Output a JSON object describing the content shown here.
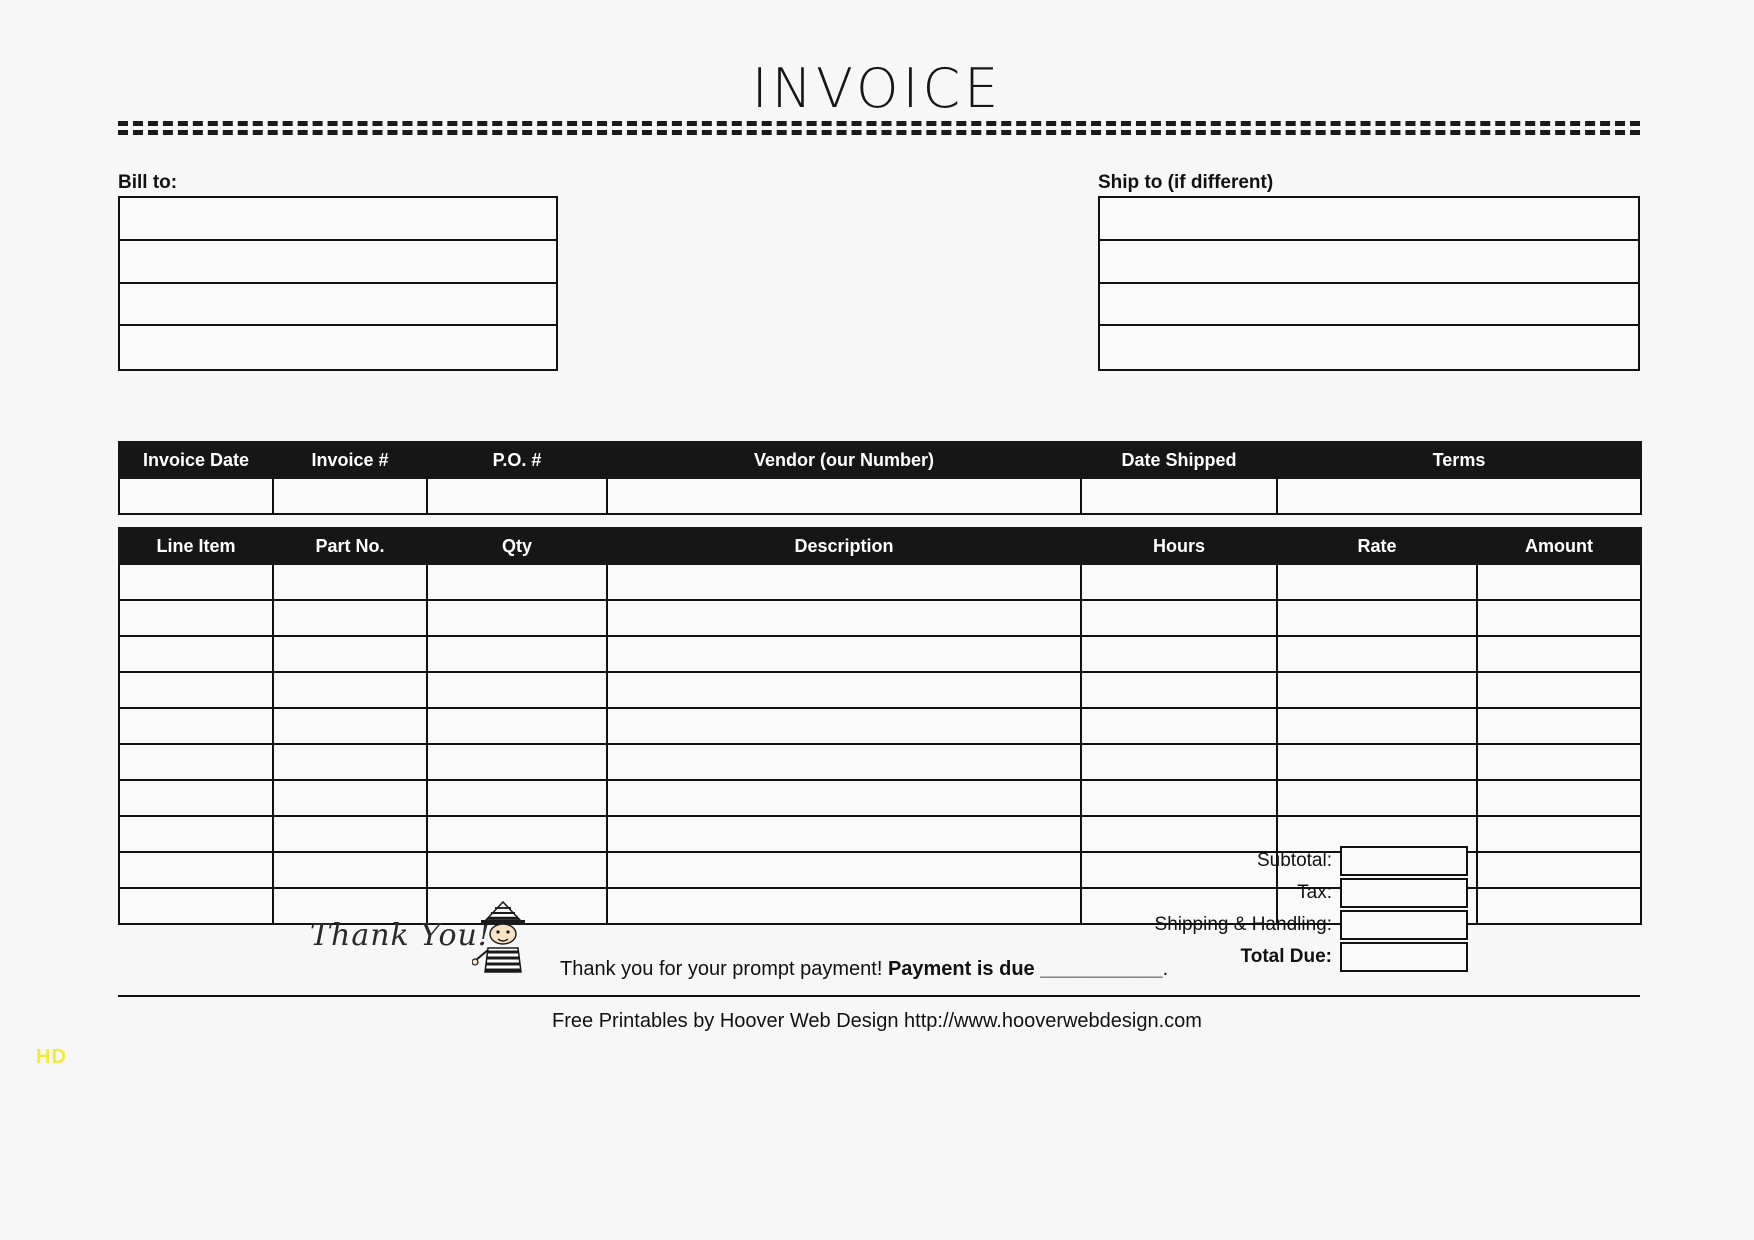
{
  "document": {
    "title": "INVOICE"
  },
  "bill_to": {
    "label": "Bill to:",
    "rows": [
      "",
      "",
      "",
      ""
    ]
  },
  "ship_to": {
    "label": "Ship to (if different)",
    "rows": [
      "",
      "",
      "",
      ""
    ]
  },
  "info_table": {
    "headers": [
      "Invoice Date",
      "Invoice #",
      "P.O. #",
      "Vendor (our Number)",
      "Date Shipped",
      "Terms"
    ],
    "values": [
      "",
      "",
      "",
      "",
      "",
      ""
    ]
  },
  "line_items_table": {
    "headers": [
      "Line Item",
      "Part No.",
      "Qty",
      "Description",
      "Hours",
      "Rate",
      "Amount"
    ],
    "rows": [
      [
        "",
        "",
        "",
        "",
        "",
        "",
        ""
      ],
      [
        "",
        "",
        "",
        "",
        "",
        "",
        ""
      ],
      [
        "",
        "",
        "",
        "",
        "",
        "",
        ""
      ],
      [
        "",
        "",
        "",
        "",
        "",
        "",
        ""
      ],
      [
        "",
        "",
        "",
        "",
        "",
        "",
        ""
      ],
      [
        "",
        "",
        "",
        "",
        "",
        "",
        ""
      ],
      [
        "",
        "",
        "",
        "",
        "",
        "",
        ""
      ],
      [
        "",
        "",
        "",
        "",
        "",
        "",
        ""
      ],
      [
        "",
        "",
        "",
        "",
        "",
        "",
        ""
      ],
      [
        "",
        "",
        "",
        "",
        "",
        "",
        ""
      ]
    ]
  },
  "totals": {
    "rows": [
      {
        "label": "Subtotal:",
        "value": "",
        "bold": false
      },
      {
        "label": "Tax:",
        "value": "",
        "bold": false
      },
      {
        "label": "Shipping & Handling:",
        "value": "",
        "bold": false
      },
      {
        "label": "Total Due:",
        "value": "",
        "bold": true
      }
    ]
  },
  "footer": {
    "thank_you_script": "Thank You!",
    "payment_note_prefix": "Thank you for your prompt payment!",
    "payment_note_bold": "Payment is due ___________",
    "payment_note_suffix": ".",
    "credit": "Free Printables by Hoover Web Design http://www.hooverwebdesign.com",
    "watermark": "HD"
  },
  "colors": {
    "header_band": "#161616",
    "header_text": "#ffffff",
    "rule": "#111111",
    "paper": "#f7f7f7",
    "watermark": "#f2ea3c"
  }
}
